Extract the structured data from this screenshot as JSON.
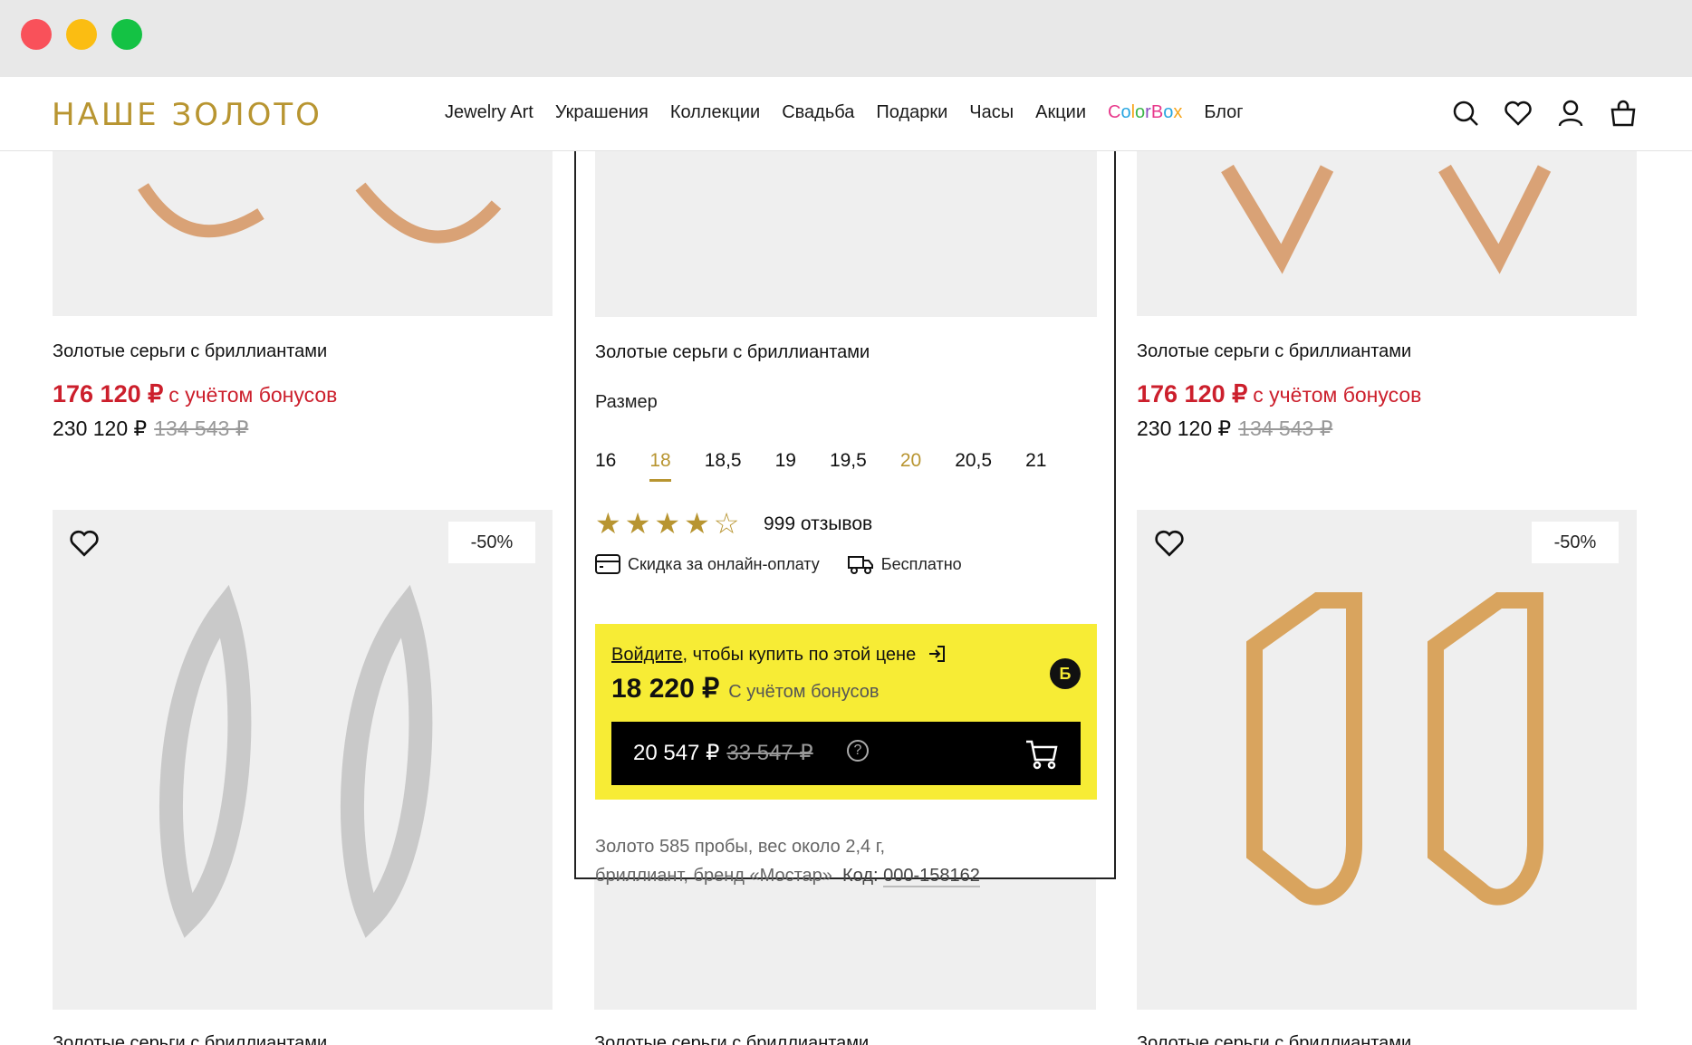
{
  "header": {
    "logo": "НАШЕ ЗОЛОТО",
    "nav": [
      "Jewelry Art",
      "Украшения",
      "Коллекции",
      "Свадьба",
      "Подарки",
      "Часы",
      "Акции"
    ],
    "colorbox": [
      "C",
      "o",
      "l",
      "o",
      "r",
      "B",
      "o",
      "x"
    ],
    "blog": "Блог",
    "icons": [
      "search-icon",
      "heart-icon",
      "user-icon",
      "bag-icon"
    ]
  },
  "cards": [
    {
      "title": "Золотые серьги с бриллиантами",
      "bonus_price": "176 120 ₽",
      "bonus_note": "с учётом бонусов",
      "price": "230 120 ₽",
      "old_price": "134 543 ₽"
    },
    {
      "title": "Золотые серьги с бриллиантами",
      "bonus_price": "176 120 ₽",
      "bonus_note": "с учётом бонусов",
      "price": "230 120 ₽",
      "old_price": "134 543 ₽"
    },
    {
      "discount": "-50%",
      "title": "Золотые серьги с бриллиантами"
    },
    {
      "title": "Золотые серьги с бриллиантами"
    },
    {
      "discount": "-50%",
      "title": "Золотые серьги с бриллиантами"
    }
  ],
  "popup": {
    "title": "Золотые серьги с бриллиантами",
    "size_label": "Размер",
    "sizes": [
      "16",
      "18",
      "18,5",
      "19",
      "19,5",
      "20",
      "20,5",
      "21"
    ],
    "selected_size": "18",
    "rating": 4,
    "reviews": "999 отзывов",
    "feature_online": "Скидка за онлайн-оплату",
    "feature_delivery": "Бесплатно",
    "login_link": "Войдите",
    "login_rest": ", чтобы купить по этой цене",
    "bonus_price": "18 220 ₽",
    "bonus_note": "С учётом бонусов",
    "bonus_badge": "Б",
    "buy_price": "20 547 ₽",
    "buy_old_price": "33 547 ₽",
    "help": "?",
    "desc_line1": "Золото 585 пробы, вес около 2,4 г,",
    "desc_line2": "бриллиант, бренд «Мостар»",
    "code_label": "Код:",
    "code_value": "000-158162"
  },
  "colors": {
    "gold": "#b89531",
    "red": "#cc1f2c",
    "yellow": "#f7ec35"
  }
}
